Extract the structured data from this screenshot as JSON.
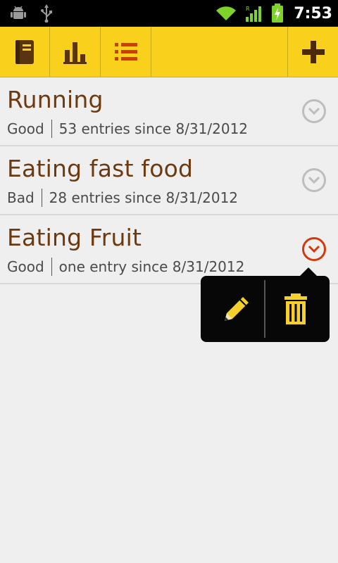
{
  "status_bar": {
    "time": "7:53",
    "icons": [
      "android-debug-icon",
      "usb-icon",
      "wifi-icon",
      "signal-icon",
      "battery-charging-icon"
    ]
  },
  "action_bar": {
    "tabs": [
      {
        "name": "journal",
        "icon": "book-icon"
      },
      {
        "name": "stats",
        "icon": "bar-chart-icon"
      },
      {
        "name": "list",
        "icon": "list-icon",
        "active": true
      }
    ],
    "add_icon": "plus-icon"
  },
  "items": [
    {
      "title": "Running",
      "rating": "Good",
      "summary": "53 entries since 8/31/2012"
    },
    {
      "title": "Eating fast food",
      "rating": "Bad",
      "summary": "28 entries since 8/31/2012"
    },
    {
      "title": "Eating Fruit",
      "rating": "Good",
      "summary": "one entry since 8/31/2012",
      "expanded": true
    }
  ],
  "popup": {
    "actions": [
      {
        "name": "edit",
        "icon": "pencil-icon"
      },
      {
        "name": "delete",
        "icon": "trash-icon"
      }
    ]
  },
  "colors": {
    "accent": "#f9d11c",
    "title_brown": "#6d3a10",
    "active_red": "#d13a0b",
    "chevron_grey": "#bdbdbd"
  }
}
